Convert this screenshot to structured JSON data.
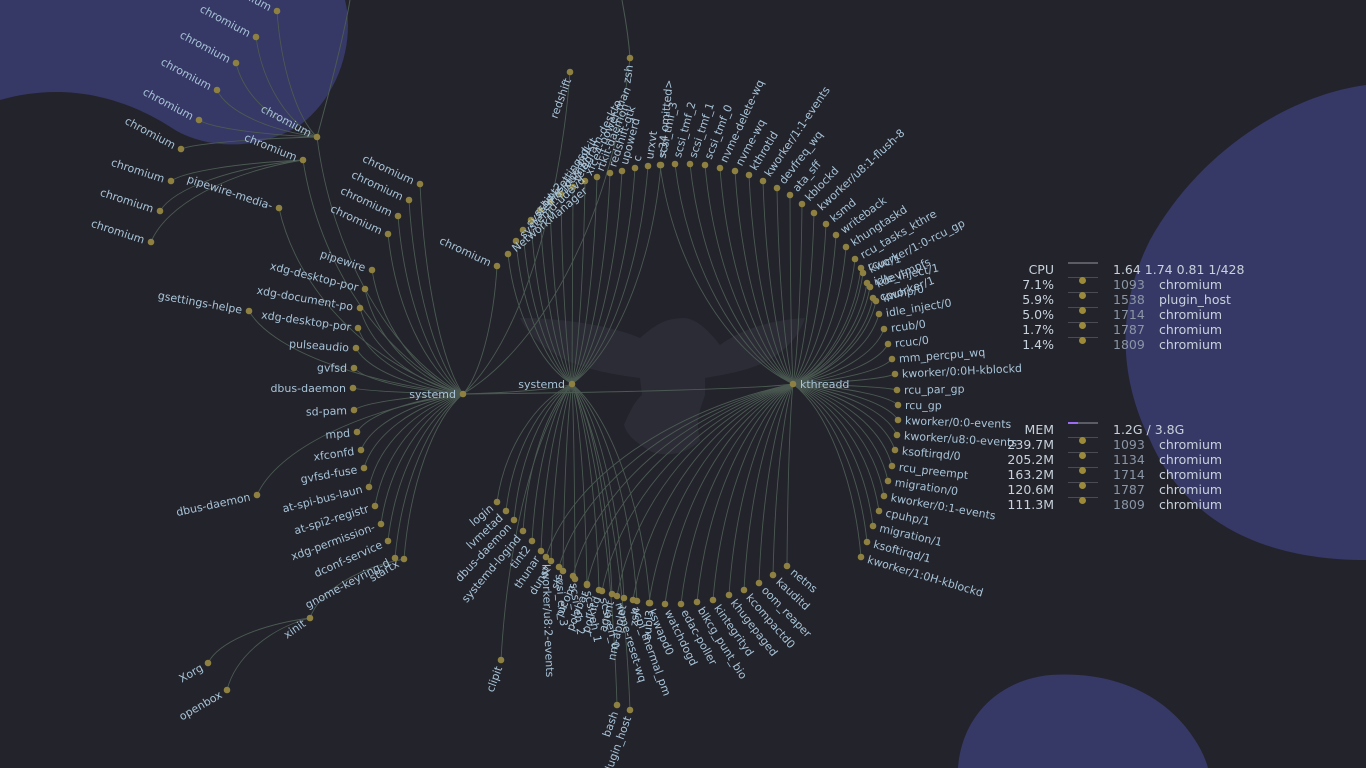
{
  "colors": {
    "background": "#23232b",
    "blob": "#363866",
    "node": "#8d8040",
    "link": "#4b5a52",
    "label": "#a8c4d8",
    "mem_bar": "#9b6cf0"
  },
  "tree": {
    "systemd_root": "systemd",
    "systemd_user": "systemd",
    "kthreadd": "kthreadd",
    "xinit": "xinit",
    "startx": "startx",
    "chromium_a": "chromium",
    "chromium_b": "chromium",
    "xinit_children": [
      "Xorg",
      "openbox"
    ],
    "chromium_a_children": [
      "chromium",
      "chromium",
      "chromium",
      "chromium",
      "chromium",
      "chromium"
    ],
    "chromium_b_children": [
      "chromium",
      "chromium",
      "chromium",
      "chromium"
    ],
    "root_left_children": [
      "gsettings-helpe",
      "dbus-daemon"
    ],
    "root_top_children": [
      "chromium",
      "chromium",
      "chromium",
      "chromium",
      "chromium",
      "pipewire-media-",
      "zsh",
      "redshift"
    ],
    "user_left_children": [
      "pipewire",
      "xdg-desktop-por",
      "xdg-document-po",
      "xdg-desktop-por",
      "pulseaudio",
      "gvfsd",
      "dbus-daemon",
      "sd-pam",
      "mpd",
      "xfconfd",
      "gvfsd-fuse",
      "at-spi-bus-laun",
      "at-spi2-registr",
      "xdg-permission-",
      "dconf-service",
      "gnome-keyring-d"
    ],
    "user_top_children": [
      "NetworkManager",
      "systemd-udevd",
      "systemd-journal",
      "sshd",
      "tint2",
      "xsettingsd",
      "xfce-polkit",
      "telegram-deskto",
      "xfce4-power-man",
      "rtkit-daemon",
      "redshift-gtk",
      "upowerd",
      "c",
      "urxvt",
      "<34 omitted>"
    ],
    "user_bottom_children": [
      "login",
      "lvmetad",
      "dbus-daemon",
      "systemd-logind",
      "tint2",
      "thunar",
      "dunst",
      "sh",
      "picom",
      "polybar",
      "polkitd",
      "agent",
      "nm-applet",
      "zsh",
      "subl3"
    ],
    "kthreadd_top_children": [
      "scsi_tmf_3",
      "scsi_tmf_2",
      "scsi_tmf_1",
      "scsi_tmf_0",
      "nvme-delete-wq",
      "nvme-wq",
      "kthrotld",
      "kworker/1:1-events",
      "devfreq_wq",
      "ata_sff",
      "kblockd",
      "kworker/u8:1-flush-8",
      "ksmd",
      "writeback",
      "khungtaskd",
      "rcu_tasks_kthre",
      "kworker/1:0-rcu_gp",
      "kdevtmpfs",
      "kworker/1"
    ],
    "kthreadd_right_children": [
      "rcuc/1",
      "idle_inject/1",
      "cpuhp/0",
      "idle_inject/0",
      "rcub/0",
      "rcuc/0",
      "mm_percpu_wq",
      "kworker/0:0H-kblockd",
      "rcu_par_gp",
      "rcu_gp",
      "kworker/0:0-events",
      "kworker/u8:0-events",
      "ksoftirqd/0",
      "rcu_preempt",
      "migration/0",
      "kworker/0:1-events",
      "cpuhp/1",
      "migration/1",
      "ksoftirqd/1",
      "kworker/1:0H-kblockd"
    ],
    "kthreadd_bottom_children": [
      "netns",
      "kauditd",
      "oom_reaper",
      "kcompactd0",
      "khugepaged",
      "kintegrityd",
      "blkcg_punt_bio",
      "edac-poller",
      "watchdogd",
      "kswapd0",
      "acpi_thermal_pm",
      "nvme-reset-wq",
      "scsi_eh_0",
      "scsi_eh_1",
      "scsi_eh_2",
      "scsi_eh_3",
      "kworker/u8:2-events"
    ],
    "bottom_children": [
      "clipit",
      "bash",
      "plugin_host"
    ]
  },
  "cpu": {
    "label": "CPU",
    "load": "1.64 1.74 0.81 1/428",
    "rows": [
      {
        "value": "7.1%",
        "pid": "1093",
        "name": "chromium"
      },
      {
        "value": "5.9%",
        "pid": "1538",
        "name": "plugin_host"
      },
      {
        "value": "5.0%",
        "pid": "1714",
        "name": "chromium"
      },
      {
        "value": "1.7%",
        "pid": "1787",
        "name": "chromium"
      },
      {
        "value": "1.4%",
        "pid": "1809",
        "name": "chromium"
      }
    ]
  },
  "mem": {
    "label": "MEM",
    "usage": "1.2G / 3.8G",
    "used_fraction": 0.32,
    "rows": [
      {
        "value": "239.7M",
        "pid": "1093",
        "name": "chromium"
      },
      {
        "value": "205.2M",
        "pid": "1134",
        "name": "chromium"
      },
      {
        "value": "163.2M",
        "pid": "1714",
        "name": "chromium"
      },
      {
        "value": "120.6M",
        "pid": "1787",
        "name": "chromium"
      },
      {
        "value": "111.3M",
        "pid": "1809",
        "name": "chromium"
      }
    ]
  }
}
